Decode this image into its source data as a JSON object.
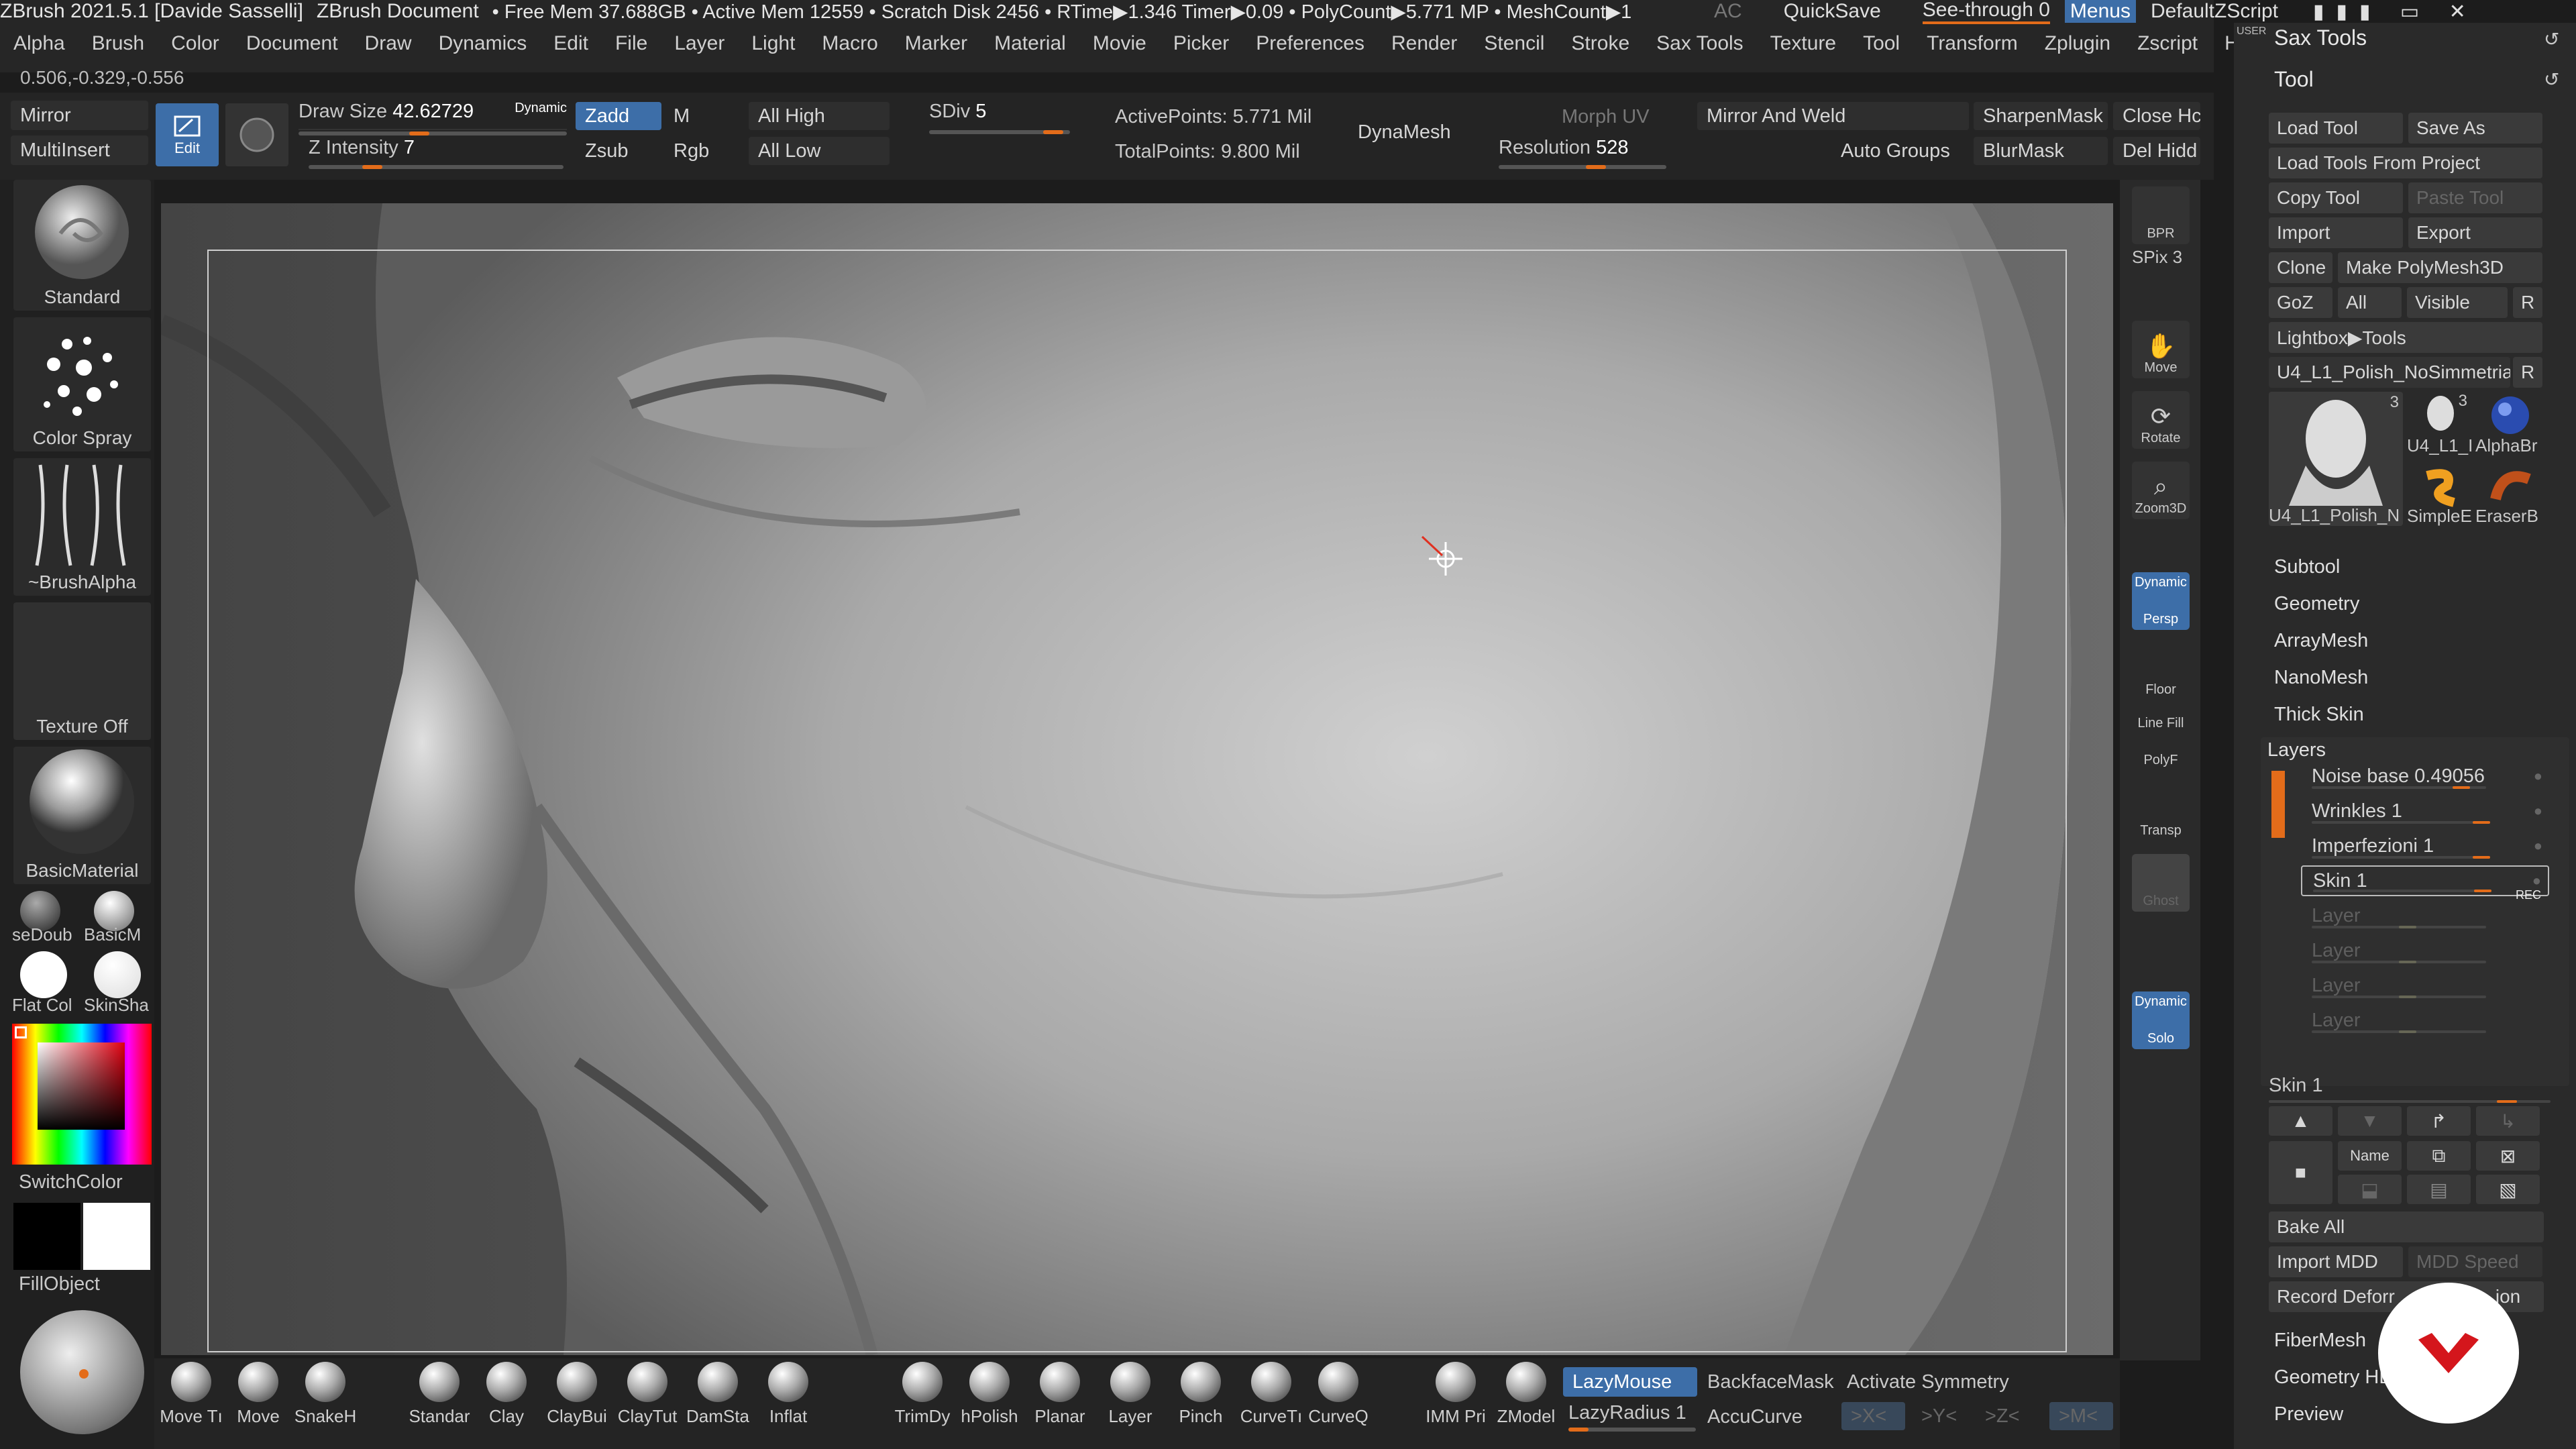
{
  "title": {
    "app": "ZBrush 2021.5.1 [Davide Sasselli]",
    "doc": "ZBrush Document",
    "stats": "• Free Mem 37.688GB • Active Mem 12559 • Scratch Disk 2456 • RTime▶1.346 Timer▶0.09 • PolyCount▶5.771 MP • MeshCount▶1",
    "ac": "AC",
    "quicksave": "QuickSave",
    "seethrough": "See-through  0",
    "menus": "Menus",
    "script": "DefaultZScript"
  },
  "menus": [
    "Alpha",
    "Brush",
    "Color",
    "Document",
    "Draw",
    "Dynamics",
    "Edit",
    "File",
    "Layer",
    "Light",
    "Macro",
    "Marker",
    "Material",
    "Movie",
    "Picker",
    "Preferences",
    "Render",
    "Stencil",
    "Stroke",
    "Sax Tools",
    "Texture",
    "Tool",
    "Transform",
    "Zplugin",
    "Zscript",
    "Help"
  ],
  "coords": "0.506,-0.329,-0.556",
  "toolbar": {
    "mirror": "Mirror",
    "multiinsert": "MultiInsert",
    "edit": "Edit",
    "draw_size_label": "Draw Size",
    "draw_size": "42.62729",
    "dynamic": "Dynamic",
    "z_intensity_label": "Z Intensity",
    "z_intensity": "7",
    "zadd": "Zadd",
    "zsub": "Zsub",
    "m": "M",
    "rgb": "Rgb",
    "all_high": "All High",
    "all_low": "All Low",
    "sdiv_label": "SDiv",
    "sdiv": "5",
    "active_points": "ActivePoints: 5.771 Mil",
    "total_points": "TotalPoints: 9.800 Mil",
    "dynamesh": "DynaMesh",
    "morph_uv": "Morph UV",
    "resolution_label": "Resolution",
    "resolution": "528",
    "mirror_weld": "Mirror And Weld",
    "auto_groups": "Auto Groups",
    "sharpen_mask": "SharpenMask",
    "blur_mask": "BlurMask",
    "close_holes": "Close Hc",
    "del_hidden": "Del Hidd"
  },
  "left": {
    "standard": "Standard",
    "color_spray": "Color Spray",
    "brush_alpha": "~BrushAlpha",
    "texture_off": "Texture Off",
    "basic_material": "BasicMaterial",
    "mat1": "seDoub",
    "mat2": "BasicM",
    "mat3": "Flat Col",
    "mat4": "SkinSha",
    "switch_color": "SwitchColor",
    "fill_object": "FillObject"
  },
  "right_strip": {
    "bpr": "BPR",
    "spix": "SPix 3",
    "move": "Move",
    "rotate": "Rotate",
    "zoom3d": "Zoom3D",
    "dynamic": "Dynamic",
    "persp": "Persp",
    "floor": "Floor",
    "line_fill": "Line Fill",
    "polyf": "PolyF",
    "transp": "Transp",
    "ghost": "Ghost",
    "solo_dyn": "Dynamic",
    "solo": "Solo"
  },
  "panel": {
    "sax_tools": "Sax Tools",
    "tool": "Tool",
    "user": "USER",
    "load_tool": "Load Tool",
    "save_as": "Save As",
    "load_from_project": "Load Tools From Project",
    "copy_tool": "Copy Tool",
    "paste_tool": "Paste Tool",
    "import": "Import",
    "export": "Export",
    "clone": "Clone",
    "make_polymesh": "Make PolyMesh3D",
    "goz": "GoZ",
    "all": "All",
    "visible": "Visible",
    "r": "R",
    "lightbox_tools": "Lightbox▶Tools",
    "current_tool": "U4_L1_Polish_NoSimmetria.",
    "r2": "R",
    "thumb_count1": "3",
    "thumb_count2": "3",
    "thumb_main": "U4_L1_Polish_N",
    "thumb_b": "U4_L1_I",
    "thumb_c": "AlphaBr",
    "thumb_d": "SimpleE",
    "thumb_e": "EraserB",
    "subtool": "Subtool",
    "geometry": "Geometry",
    "arraymesh": "ArrayMesh",
    "nanomesh": "NanoMesh",
    "thickskin": "Thick Skin",
    "layers": "Layers",
    "layer_items": [
      {
        "name": "Noise base 0.49056",
        "value": 0.49
      },
      {
        "name": "Wrinkles 1",
        "value": 1
      },
      {
        "name": "Imperfezioni 1",
        "value": 1
      },
      {
        "name": "Skin 1",
        "value": 1
      },
      {
        "name": "Layer",
        "value": 0
      },
      {
        "name": "Layer",
        "value": 0
      },
      {
        "name": "Layer",
        "value": 0
      },
      {
        "name": "Layer",
        "value": 0
      }
    ],
    "rec": "REC",
    "skin_slider": "Skin 1",
    "name_btn": "Name",
    "bake_all": "Bake All",
    "import_mdd": "Import MDD",
    "mdd_speed": "MDD Speed",
    "record_deform": "Record Deforr",
    "record_deform_tail": "ion",
    "fibermesh": "FiberMesh",
    "geometry_hd": "Geometry HD",
    "preview": "Preview"
  },
  "bottom": {
    "brushes": [
      "Move Tı",
      "Move",
      "SnakeH",
      "Standar",
      "Clay",
      "ClayBui",
      "ClayTut",
      "DamSta",
      "Inflat",
      "TrimDy",
      "hPolish",
      "Planar",
      "Layer",
      "Pinch",
      "CurveTı",
      "CurveQ",
      "IMM Pri",
      "ZModel"
    ],
    "lazymouse": "LazyMouse",
    "lazyradius": "LazyRadius 1",
    "backfacemask": "BackfaceMask",
    "accucurve": "AccuCurve",
    "activate_symmetry": "Activate Symmetry",
    "x": ">X<",
    "y": ">Y<",
    "z": ">Z<",
    "m": ">M<"
  },
  "colors": {
    "accent": "#e36c1a",
    "active_blue": "#3d6ea8",
    "logo_red": "#d4161c"
  }
}
